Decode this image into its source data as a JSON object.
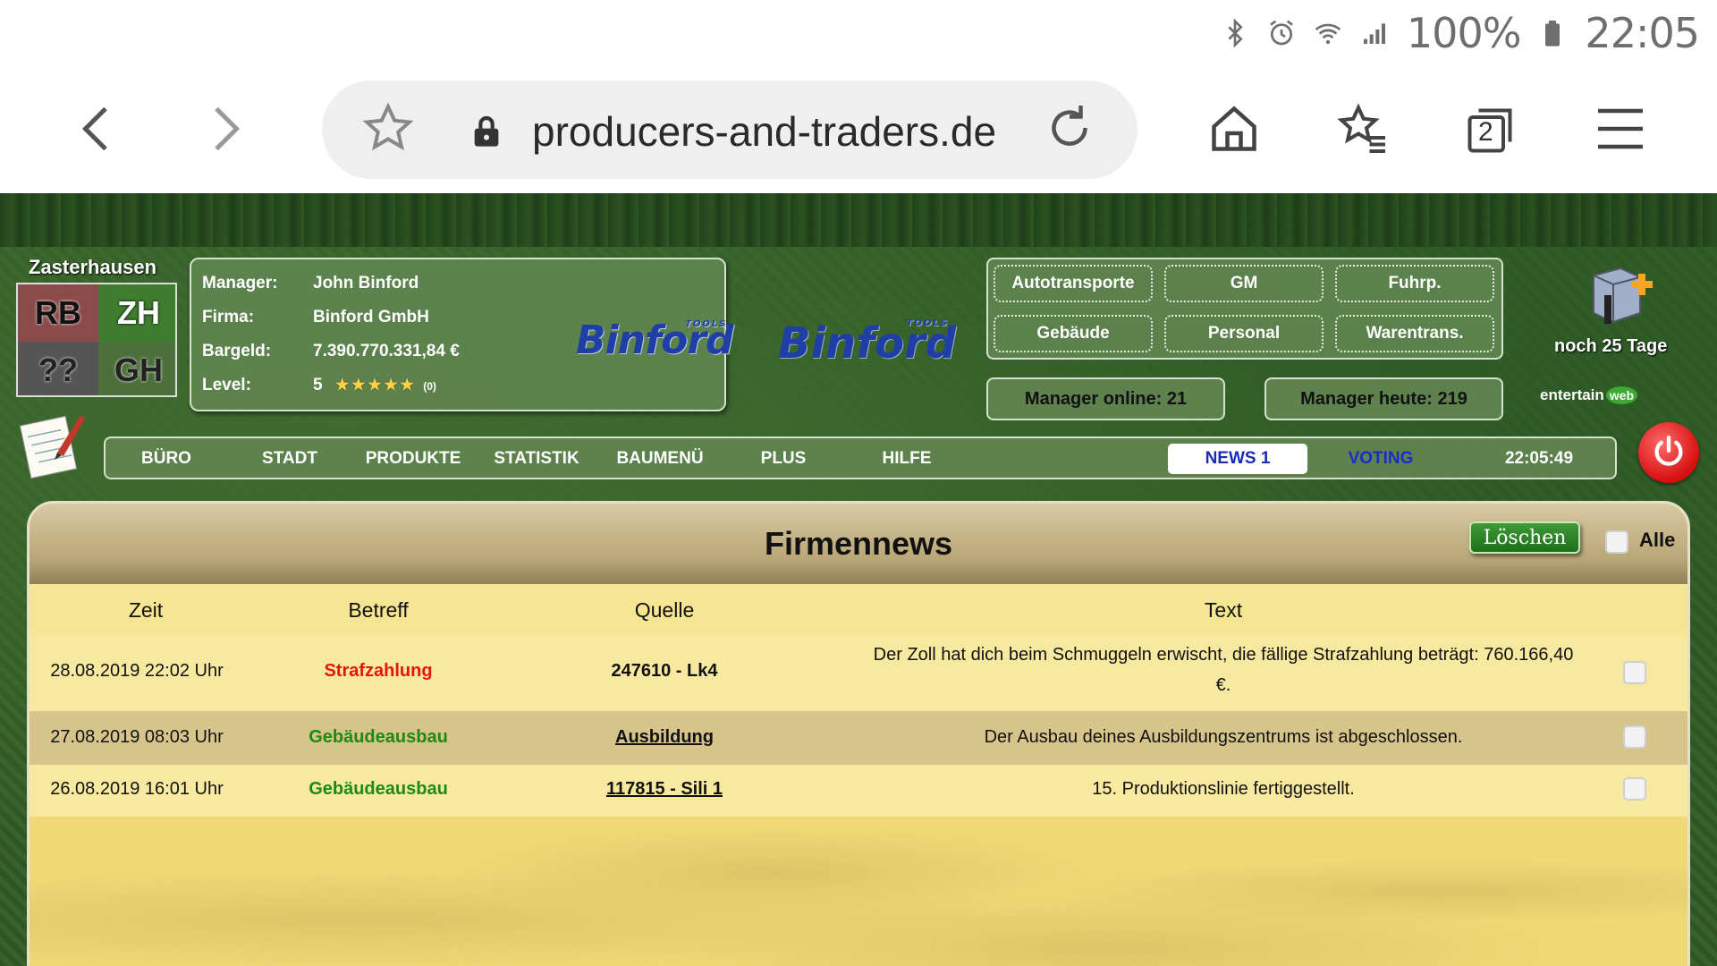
{
  "status": {
    "battery": "100%",
    "time": "22:05"
  },
  "browser": {
    "url": "producers-and-traders.de",
    "tab_count": "2"
  },
  "game": {
    "city_name": "Zasterhausen",
    "minimap": [
      "RB",
      "ZH",
      "??",
      "GH"
    ],
    "info": {
      "manager_label": "Manager:",
      "manager": "John Binford",
      "firma_label": "Firma:",
      "firma": "Binford GmbH",
      "bargeld_label": "Bargeld:",
      "bargeld": "7.390.770.331,84 €",
      "level_label": "Level:",
      "level": "5",
      "stars": "★★★★★",
      "stars_count": "(0)"
    },
    "logo": {
      "brand": "Binford",
      "sub": "TOOLS"
    },
    "menu": [
      "Autotransporte",
      "GM",
      "Fuhrp.",
      "Gebäude",
      "Personal",
      "Warentrans."
    ],
    "counters": {
      "online_label": "Manager online:",
      "online_value": "21",
      "today_label": "Manager heute:",
      "today_value": "219"
    },
    "promo": {
      "text": "noch 25 Tage",
      "partner": "entertain",
      "partner_badge": "web"
    },
    "nav": {
      "items": [
        "BÜRO",
        "STADT",
        "PRODUKTE",
        "STATISTIK",
        "BAUMENÜ",
        "PLUS",
        "HILFE",
        "NEWS 1",
        "VOTING"
      ],
      "clock": "22:05:49"
    }
  },
  "news": {
    "title": "Firmennews",
    "delete_label": "Löschen",
    "all_label": "Alle",
    "columns": [
      "Zeit",
      "Betreff",
      "Quelle",
      "Text"
    ],
    "rows": [
      {
        "zeit": "28.08.2019 22:02 Uhr",
        "betreff": "Strafzahlung",
        "quelle": "247610 - Lk4",
        "text_line1": "Der Zoll hat dich beim Schmuggeln erwischt, die fällige Strafzahlung beträgt: 760.166,40",
        "text_line2": "€."
      },
      {
        "zeit": "27.08.2019 08:03 Uhr",
        "betreff": "Gebäudeausbau",
        "quelle": "Ausbildung",
        "text_line1": "Der Ausbau deines Ausbildungszentrums ist abgeschlossen."
      },
      {
        "zeit": "26.08.2019 16:01 Uhr",
        "betreff": "Gebäudeausbau",
        "quelle": "117815 - Sili 1",
        "text_line1": "15. Produktionslinie fertiggestellt."
      }
    ]
  }
}
